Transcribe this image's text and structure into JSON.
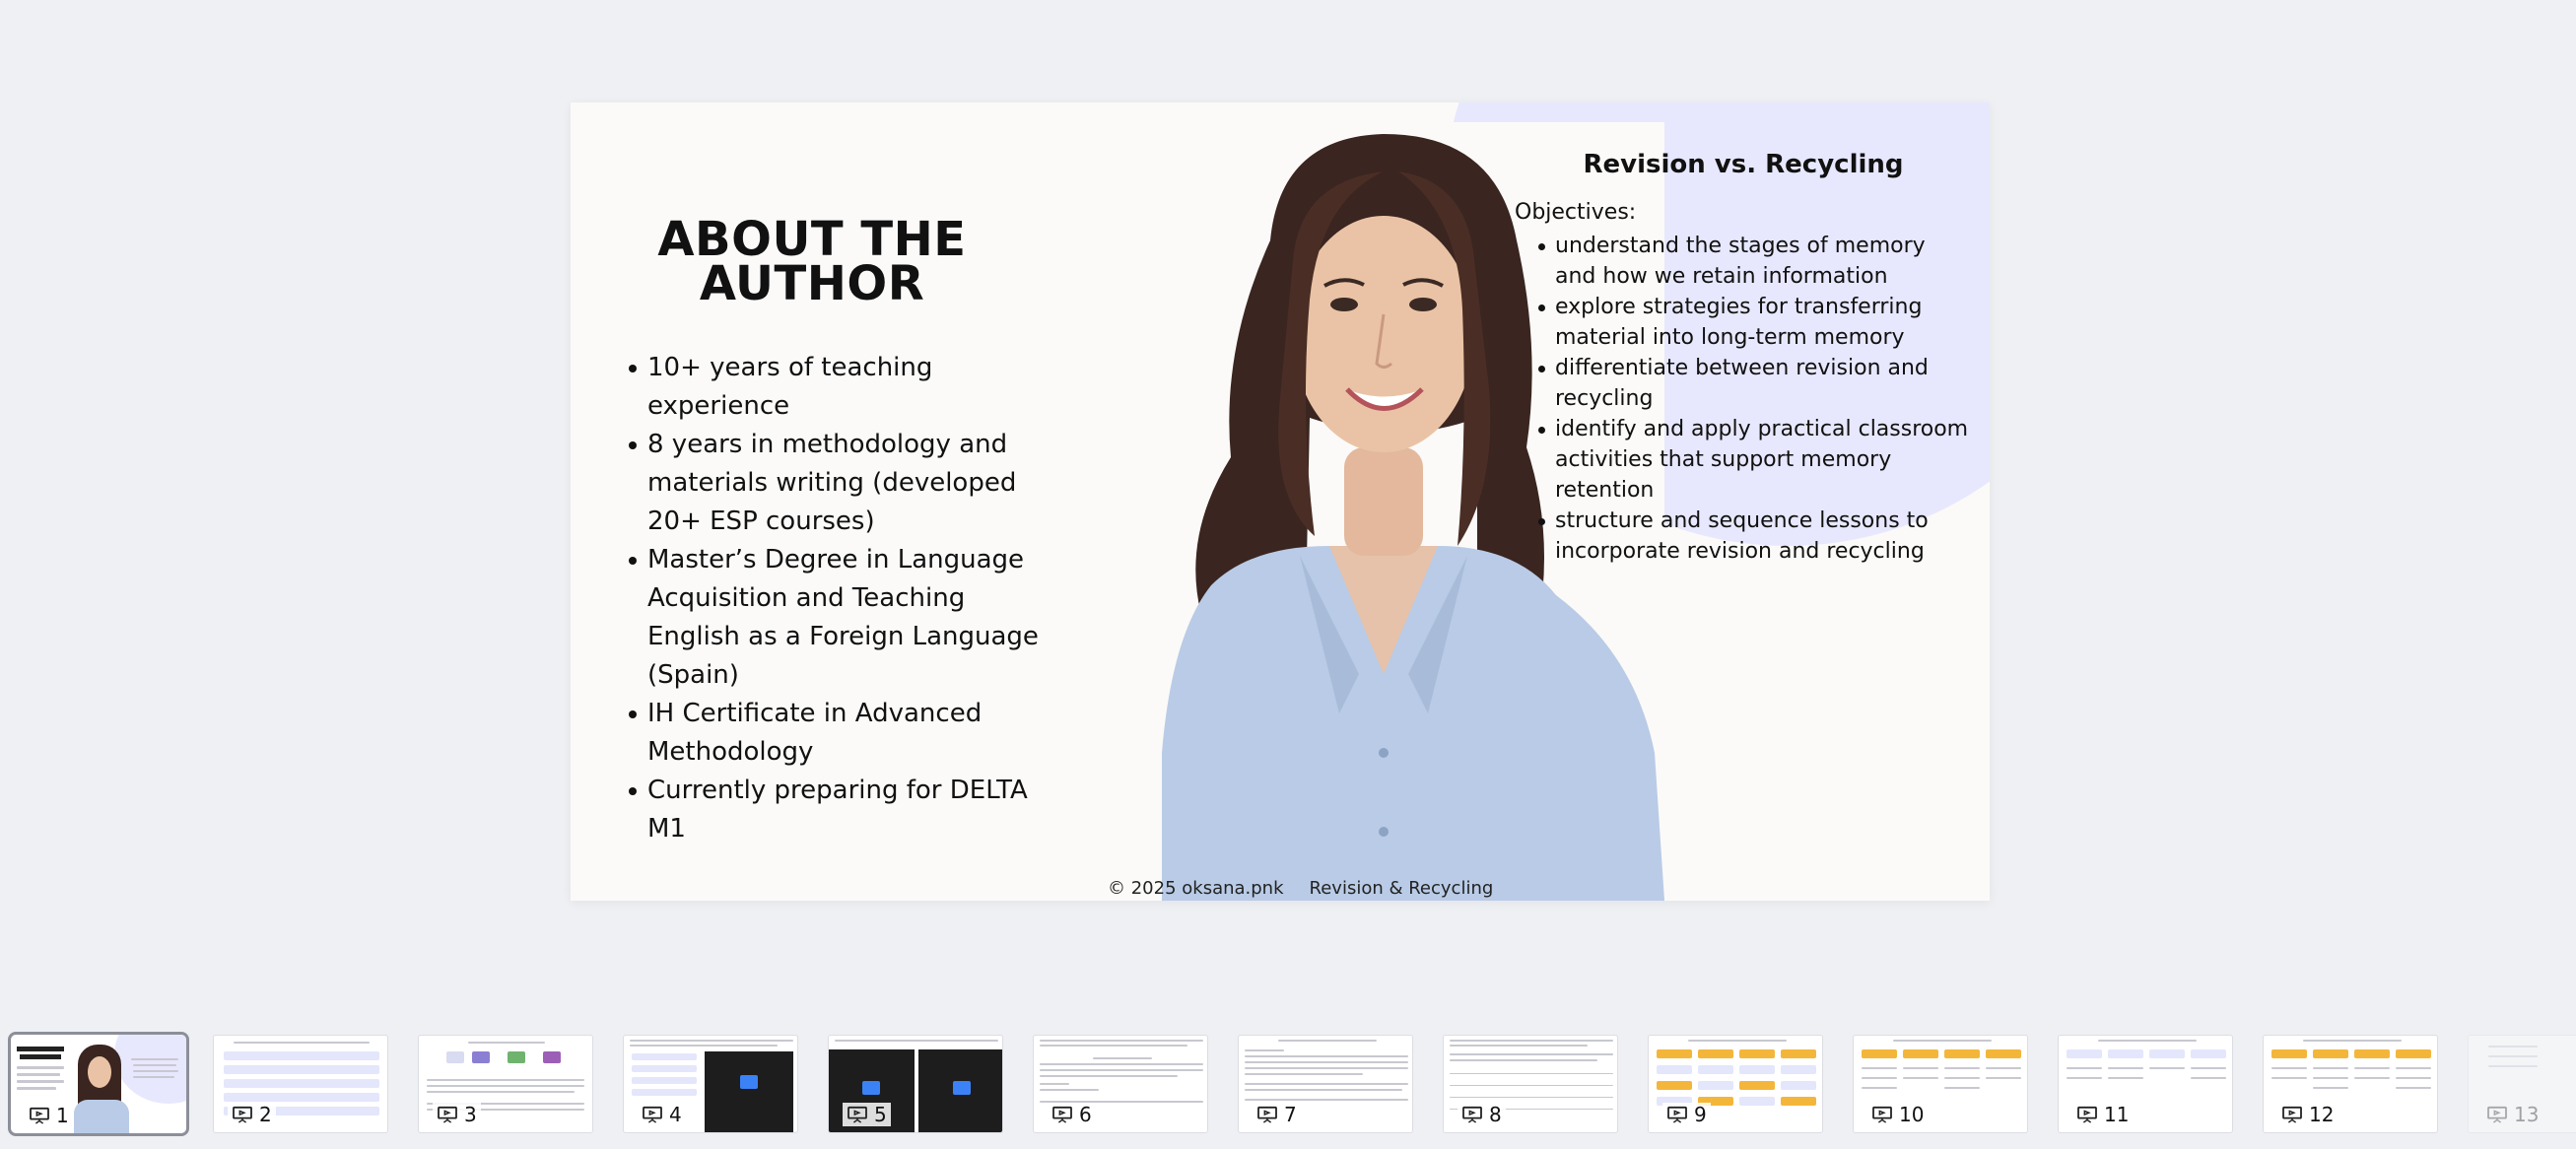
{
  "slide": {
    "about_title": "ABOUT THE AUTHOR",
    "about_items": [
      "10+ years of teaching experience",
      "8 years in methodology and materials writing (developed 20+ ESP courses)",
      "Master’s Degree in Language Acquisition and Teaching English as a Foreign Language (Spain)",
      "IH Certificate in Advanced Methodology",
      "Currently preparing for DELTA M1"
    ],
    "right_title": "Revision vs. Recycling",
    "objectives_label": "Objectives:",
    "objectives": [
      "understand the stages of memory and how we retain information",
      "explore strategies for transferring material into long-term memory",
      "differentiate between revision and recycling",
      "identify and apply practical classroom activities that support memory retention",
      "structure and sequence lessons to incorporate revision and recycling"
    ],
    "footer_copyright": "© 2025 oksana.pnk",
    "footer_topic": "Revision & Recycling"
  },
  "thumbnails": [
    {
      "number": "1",
      "active": true
    },
    {
      "number": "2"
    },
    {
      "number": "3"
    },
    {
      "number": "4"
    },
    {
      "number": "5"
    },
    {
      "number": "6"
    },
    {
      "number": "7"
    },
    {
      "number": "8"
    },
    {
      "number": "9"
    },
    {
      "number": "10"
    },
    {
      "number": "11"
    },
    {
      "number": "12"
    },
    {
      "number": "13",
      "faded": true
    }
  ],
  "colors": {
    "background": "#eff0f4",
    "slide": "#fbfaf8",
    "blob": "#e7e8fd",
    "accent_yellow": "#f4b63a",
    "accent_blue": "#3b82f6"
  },
  "icons": [
    "presentation-icon",
    "play-icon"
  ]
}
